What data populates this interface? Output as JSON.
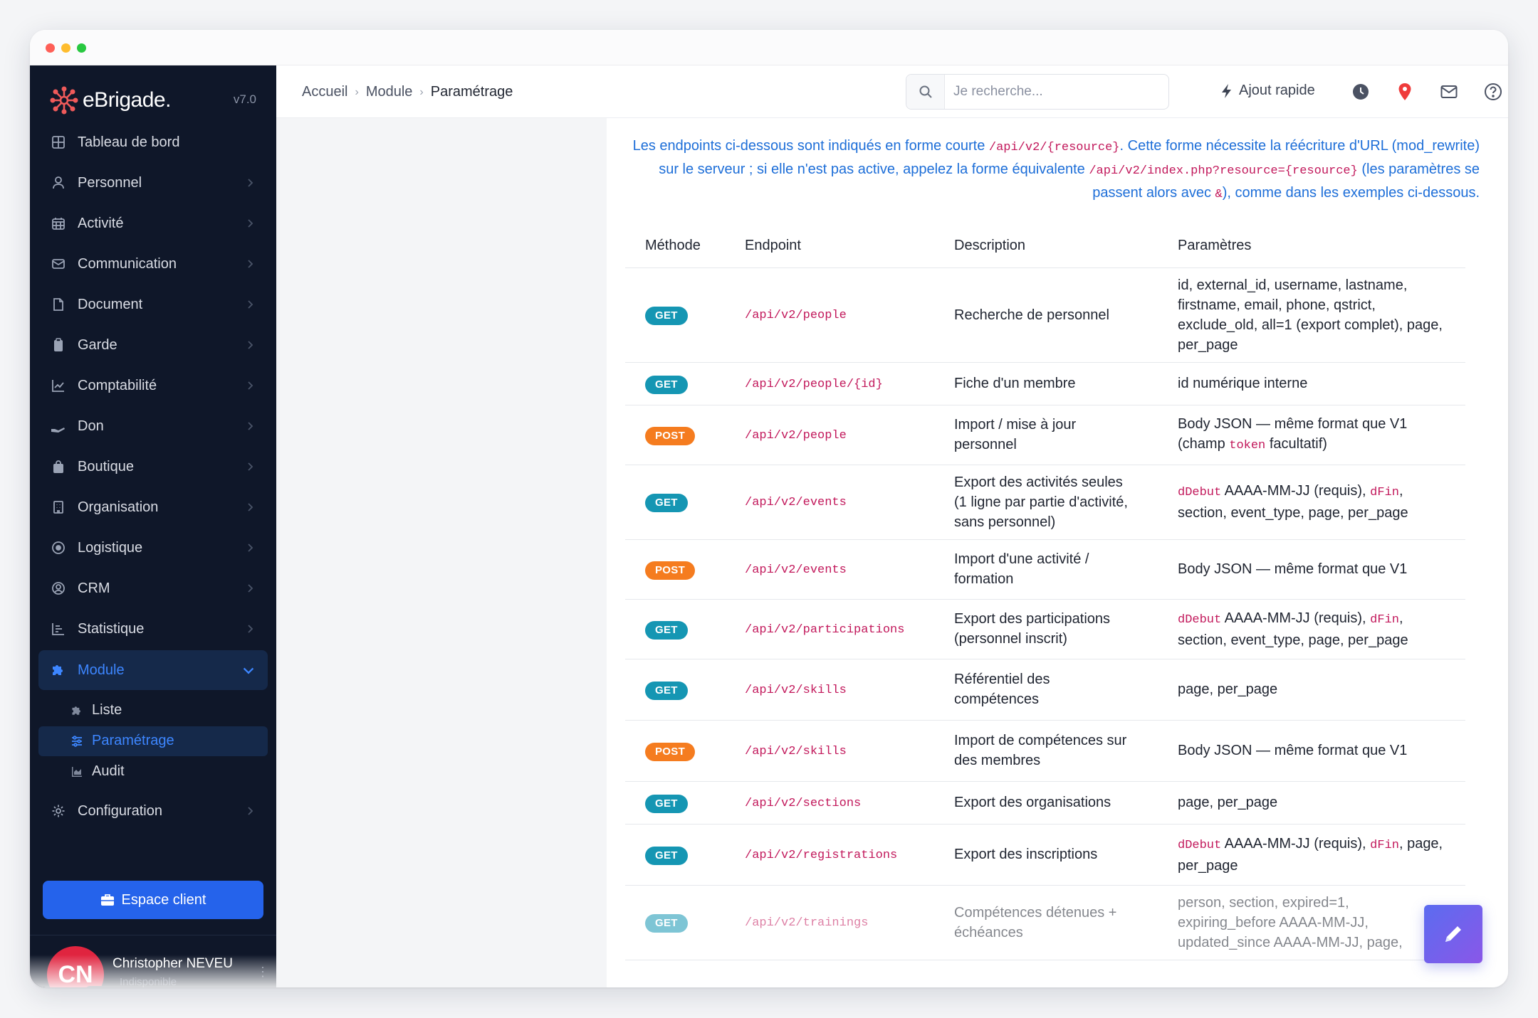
{
  "brand": {
    "name": "eBrigade.",
    "version": "v7.0"
  },
  "sidebar": {
    "items": [
      {
        "label": "Tableau de bord",
        "icon": "grid-icon"
      },
      {
        "label": "Personnel",
        "icon": "user-icon"
      },
      {
        "label": "Activité",
        "icon": "calendar-icon"
      },
      {
        "label": "Communication",
        "icon": "mail-icon"
      },
      {
        "label": "Document",
        "icon": "file-icon"
      },
      {
        "label": "Garde",
        "icon": "clipboard-icon"
      },
      {
        "label": "Comptabilité",
        "icon": "chart-line-icon"
      },
      {
        "label": "Don",
        "icon": "hand-icon"
      },
      {
        "label": "Boutique",
        "icon": "bag-icon"
      },
      {
        "label": "Organisation",
        "icon": "building-icon"
      },
      {
        "label": "Logistique",
        "icon": "target-icon"
      },
      {
        "label": "CRM",
        "icon": "user-circle-icon"
      },
      {
        "label": "Statistique",
        "icon": "bars-icon"
      },
      {
        "label": "Module",
        "icon": "puzzle-icon"
      }
    ],
    "module_sub": [
      {
        "label": "Liste",
        "icon": "puzzle-small-icon"
      },
      {
        "label": "Paramétrage",
        "icon": "sliders-icon"
      },
      {
        "label": "Audit",
        "icon": "chart-area-icon"
      }
    ],
    "config_label": "Configuration",
    "client_button": "Espace client"
  },
  "user": {
    "initials": "CN",
    "name": "Christopher NEVEU",
    "status": "Indisponible"
  },
  "breadcrumb": {
    "home": "Accueil",
    "module": "Module",
    "current": "Paramétrage"
  },
  "search": {
    "placeholder": "Je recherche..."
  },
  "quick_add": "Ajout rapide",
  "note": {
    "p1": "Les endpoints ci-dessous sont indiqués en forme courte ",
    "c1": "/api/v2/{resource}",
    "p2": ". Cette forme nécessite la réécriture d'URL (mod_rewrite) sur le serveur ; si elle n'est pas active, appelez la forme équivalente ",
    "c2": "/api/v2/index.php?resource={resource}",
    "p3": " (les paramètres se passent alors avec ",
    "c3": "&",
    "p4": "), comme dans les exemples ci-dessous."
  },
  "table": {
    "headers": [
      "Méthode",
      "Endpoint",
      "Description",
      "Paramètres"
    ],
    "rows": [
      {
        "method": "GET",
        "endpoint": "/api/v2/people",
        "desc": "Recherche de personnel",
        "params": "id, external_id, username, lastname, firstname, email, phone, qstrict, exclude_old, all=1 (export complet), page, per_page"
      },
      {
        "method": "GET",
        "endpoint": "/api/v2/people/{id}",
        "desc": "Fiche d'un membre",
        "params": "id numérique interne"
      },
      {
        "method": "POST",
        "endpoint": "/api/v2/people",
        "desc": "Import / mise à jour personnel",
        "params_pre": "Body JSON — même format que V1 (champ ",
        "params_code": "token",
        "params_post": " facultatif)"
      },
      {
        "method": "GET",
        "endpoint": "/api/v2/events",
        "desc": "Export des activités seules (1 ligne par partie d'activité, sans personnel)",
        "pc1": "dDebut",
        "pt1": " AAAA-MM-JJ (requis), ",
        "pc2": "dFin",
        "pt2": ", section, event_type, page, per_page"
      },
      {
        "method": "POST",
        "endpoint": "/api/v2/events",
        "desc": "Import d'une activité / formation",
        "params": "Body JSON — même format que V1"
      },
      {
        "method": "GET",
        "endpoint": "/api/v2/participations",
        "desc": "Export des participations (personnel inscrit)",
        "pc1": "dDebut",
        "pt1": " AAAA-MM-JJ (requis), ",
        "pc2": "dFin",
        "pt2": ", section, event_type, page, per_page"
      },
      {
        "method": "GET",
        "endpoint": "/api/v2/skills",
        "desc": "Référentiel des compétences",
        "params": "page, per_page"
      },
      {
        "method": "POST",
        "endpoint": "/api/v2/skills",
        "desc": "Import de compétences sur des membres",
        "params": "Body JSON — même format que V1"
      },
      {
        "method": "GET",
        "endpoint": "/api/v2/sections",
        "desc": "Export des organisations",
        "params": "page, per_page"
      },
      {
        "method": "GET",
        "endpoint": "/api/v2/registrations",
        "desc": "Export des inscriptions",
        "pc1": "dDebut",
        "pt1": " AAAA-MM-JJ (requis), ",
        "pc2": "dFin",
        "pt2": ", page, per_page"
      },
      {
        "method": "GET",
        "endpoint": "/api/v2/trainings",
        "desc": "Compétences détenues + échéances",
        "params": "person, section, expired=1, expiring_before AAAA-MM-JJ, updated_since AAAA-MM-JJ, page,"
      }
    ]
  },
  "colors": {
    "sidebar_bg": "#0f1729",
    "accent": "#2563eb",
    "get_badge": "#1596b3",
    "post_badge": "#f57c1f",
    "code": "#c2185b",
    "note_text": "#1d6ed8"
  }
}
